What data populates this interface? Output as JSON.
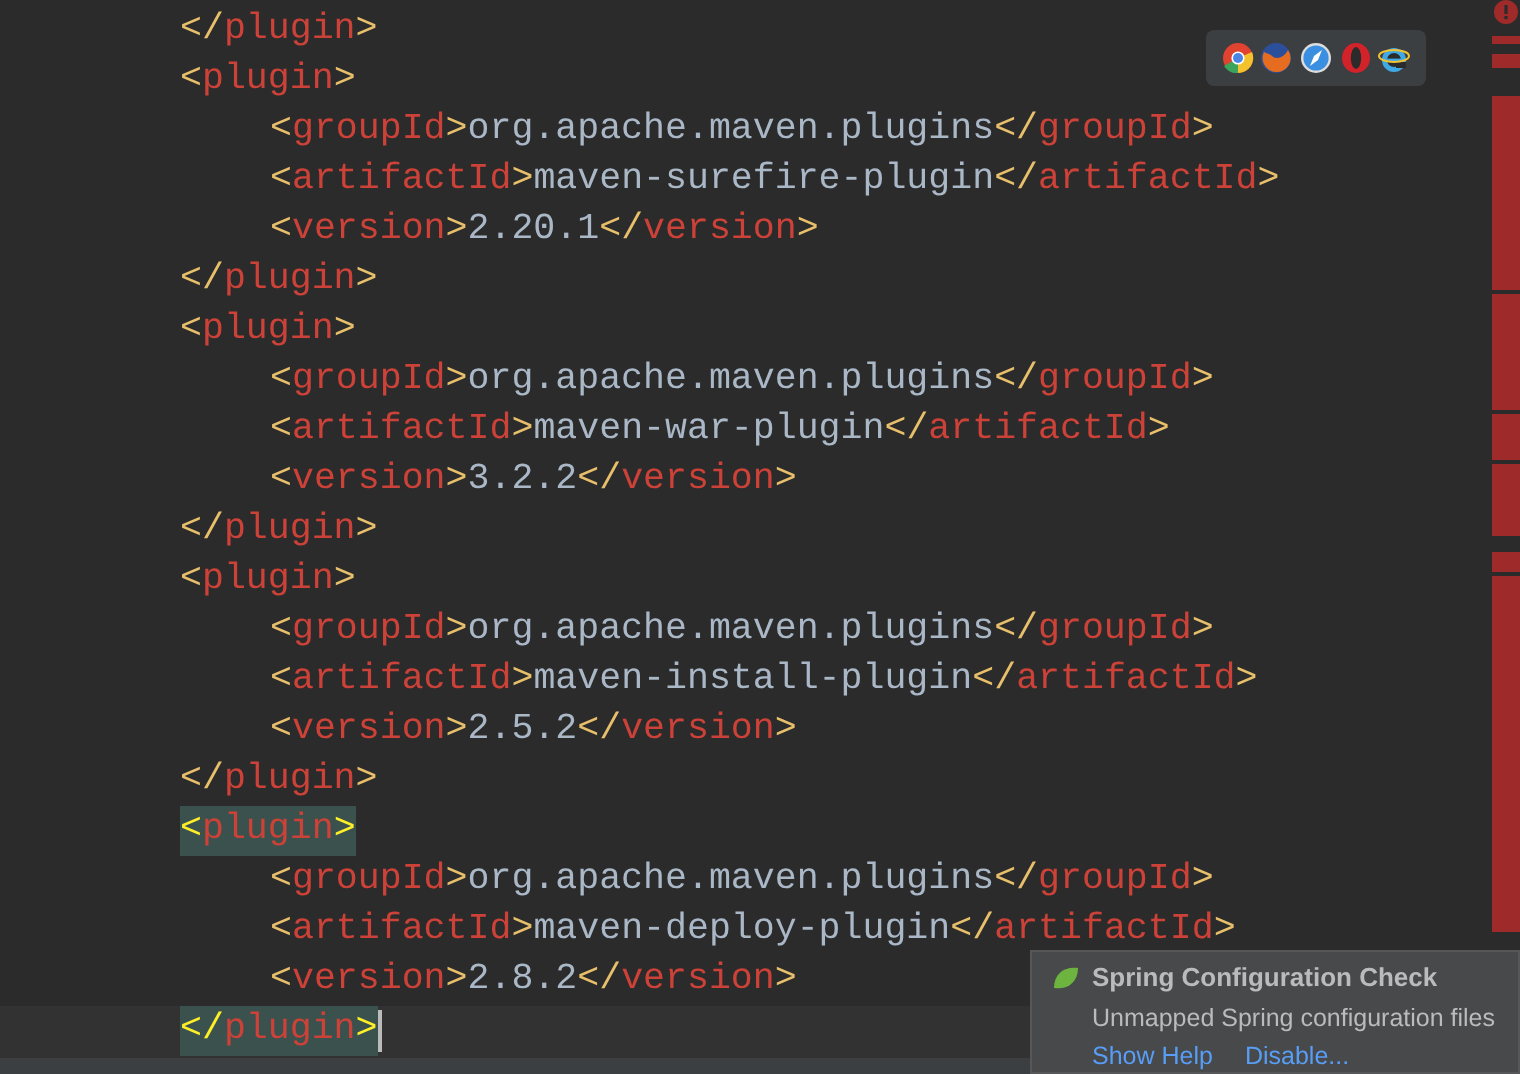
{
  "code": [
    {
      "kind": "line",
      "text": "</plugin>"
    },
    {
      "kind": "element",
      "open": "<plugin>",
      "highlighted": false,
      "close": "</plugin>",
      "children": [
        {
          "kind": "field",
          "open": "<groupId>",
          "value": "org.apache.maven.plugins",
          "close": "</groupId>"
        },
        {
          "kind": "field",
          "open": "<artifactId>",
          "value": "maven-surefire-plugin",
          "close": "</artifactId>"
        },
        {
          "kind": "field",
          "open": "<version>",
          "value": "2.20.1",
          "close": "</version>"
        }
      ]
    },
    {
      "kind": "element",
      "open": "<plugin>",
      "highlighted": false,
      "close": "</plugin>",
      "children": [
        {
          "kind": "field",
          "open": "<groupId>",
          "value": "org.apache.maven.plugins",
          "close": "</groupId>"
        },
        {
          "kind": "field",
          "open": "<artifactId>",
          "value": "maven-war-plugin",
          "close": "</artifactId>"
        },
        {
          "kind": "field",
          "open": "<version>",
          "value": "3.2.2",
          "close": "</version>"
        }
      ]
    },
    {
      "kind": "element",
      "open": "<plugin>",
      "highlighted": false,
      "close": "</plugin>",
      "children": [
        {
          "kind": "field",
          "open": "<groupId>",
          "value": "org.apache.maven.plugins",
          "close": "</groupId>"
        },
        {
          "kind": "field",
          "open": "<artifactId>",
          "value": "maven-install-plugin",
          "close": "</artifactId>"
        },
        {
          "kind": "field",
          "open": "<version>",
          "value": "2.5.2",
          "close": "</version>"
        }
      ]
    },
    {
      "kind": "element",
      "open": "<plugin>",
      "highlighted": true,
      "close": "</plugin>",
      "children": [
        {
          "kind": "field",
          "open": "<groupId>",
          "value": "org.apache.maven.plugins",
          "close": "</groupId>"
        },
        {
          "kind": "field",
          "open": "<artifactId>",
          "value": "maven-deploy-plugin",
          "close": "</artifactId>"
        },
        {
          "kind": "field",
          "open": "<version>",
          "value": "2.8.2",
          "close": "</version>"
        }
      ]
    }
  ],
  "notification": {
    "title": "Spring Configuration Check",
    "message": "Unmapped Spring configuration files",
    "links": [
      "Show Help",
      "Disable..."
    ]
  }
}
